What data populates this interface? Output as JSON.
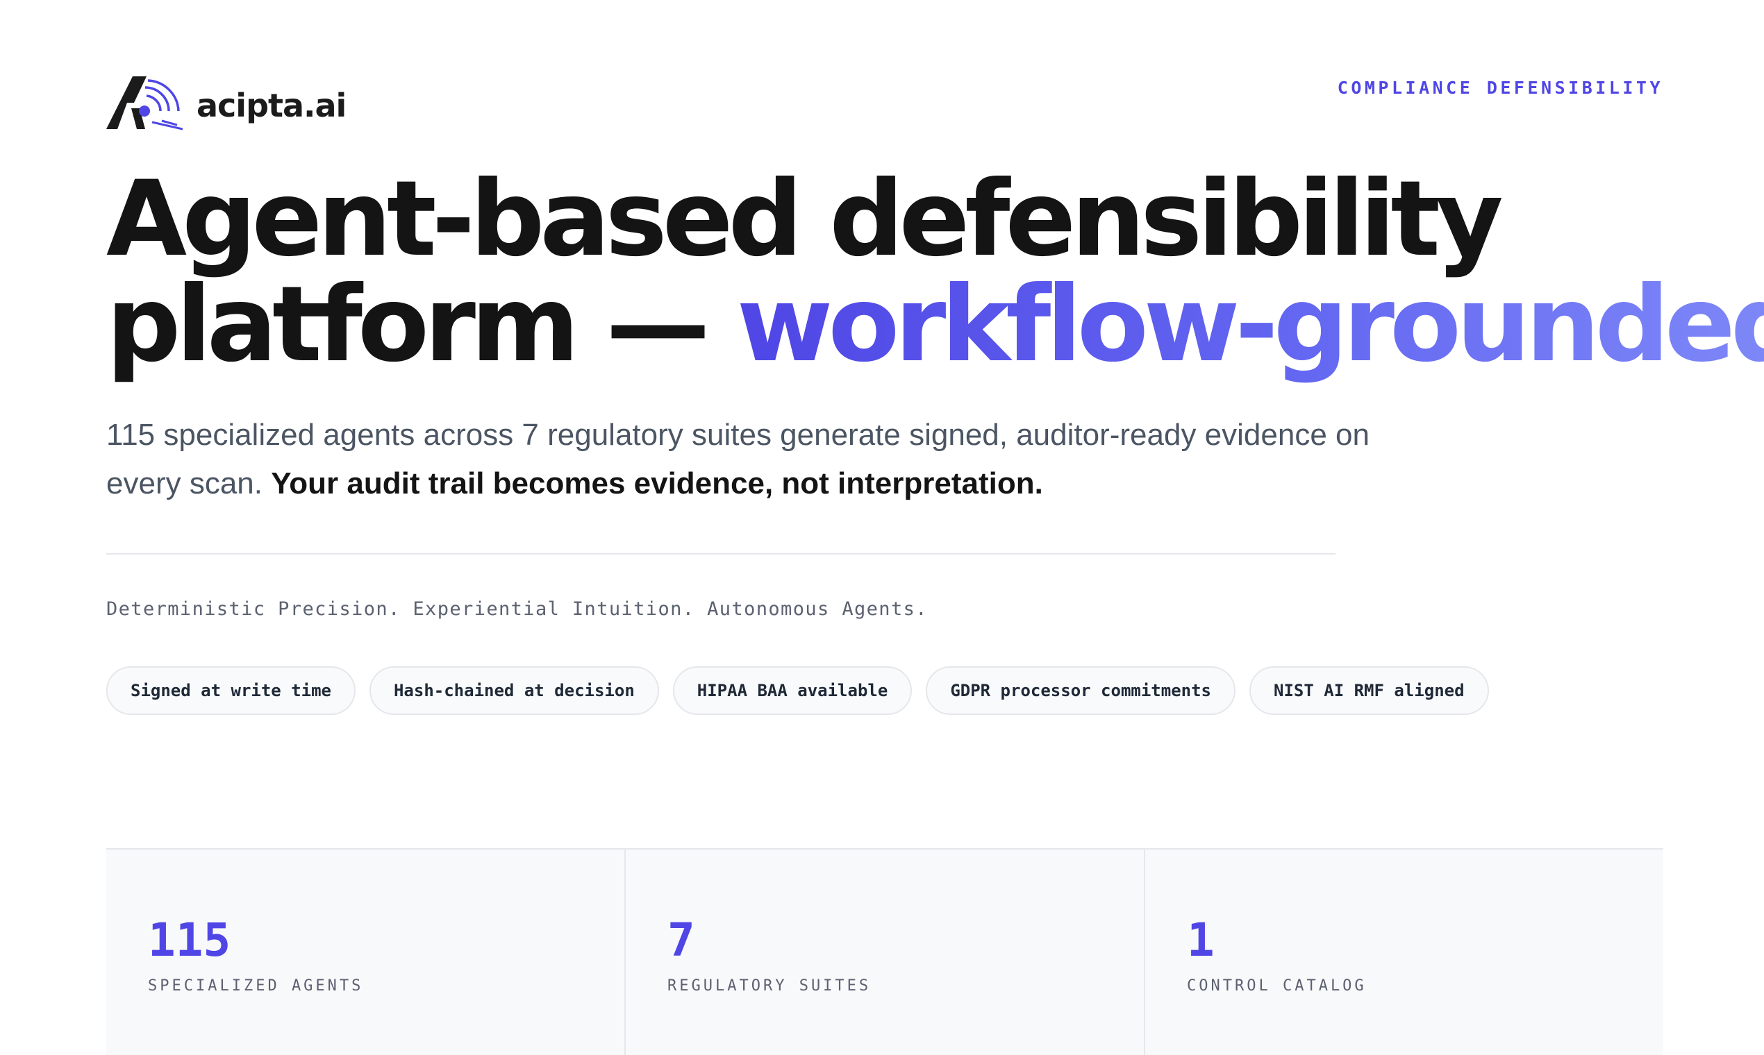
{
  "brand": {
    "name": "acipta.ai",
    "accent_color": "#4f46e5",
    "logo_icon": "acipta-logo-icon"
  },
  "header": {
    "eyebrow": "COMPLIANCE DEFENSIBILITY"
  },
  "hero": {
    "headline_line1": "Agent-based defensibility",
    "headline_line2_plain": "platform — ",
    "headline_line2_accent": "workflow-grounded.",
    "lede_plain": "115 specialized agents across 7 regulatory suites generate signed, auditor-ready evidence on every scan.",
    "lede_strong": "Your audit trail becomes evidence, not interpretation."
  },
  "tagline": "Deterministic Precision. Experiential Intuition. Autonomous Agents.",
  "pills": [
    {
      "label": "Signed at write time"
    },
    {
      "label": "Hash-chained at decision"
    },
    {
      "label": "HIPAA BAA available"
    },
    {
      "label": "GDPR processor commitments"
    },
    {
      "label": "NIST AI RMF aligned"
    }
  ],
  "stats": [
    {
      "value": "115",
      "label": "SPECIALIZED AGENTS"
    },
    {
      "value": "7",
      "label": "REGULATORY SUITES"
    },
    {
      "value": "1",
      "label": "CONTROL CATALOG"
    }
  ]
}
